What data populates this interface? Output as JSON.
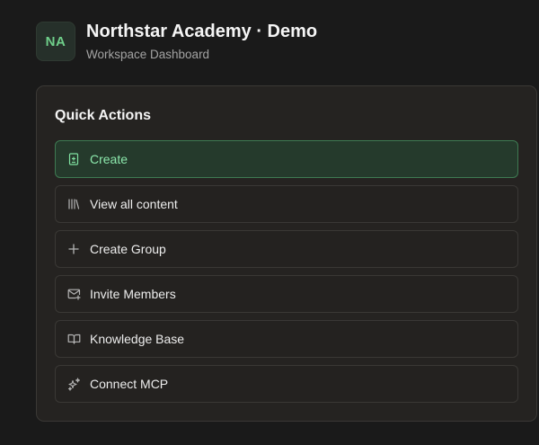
{
  "header": {
    "avatar_initials": "NA",
    "title": "Northstar Academy · Demo",
    "subtitle": "Workspace Dashboard"
  },
  "quick_actions": {
    "title": "Quick Actions",
    "items": [
      {
        "label": "Create",
        "icon": "file-plus-icon"
      },
      {
        "label": "View all content",
        "icon": "library-icon"
      },
      {
        "label": "Create Group",
        "icon": "plus-icon"
      },
      {
        "label": "Invite Members",
        "icon": "mail-plus-icon"
      },
      {
        "label": "Knowledge Base",
        "icon": "book-open-icon"
      },
      {
        "label": "Connect MCP",
        "icon": "sparkles-icon"
      }
    ]
  },
  "colors": {
    "background": "#1a1a1a",
    "card": "#252321",
    "accent": "#6fcf8a",
    "primary_action_bg": "#253a2c"
  }
}
